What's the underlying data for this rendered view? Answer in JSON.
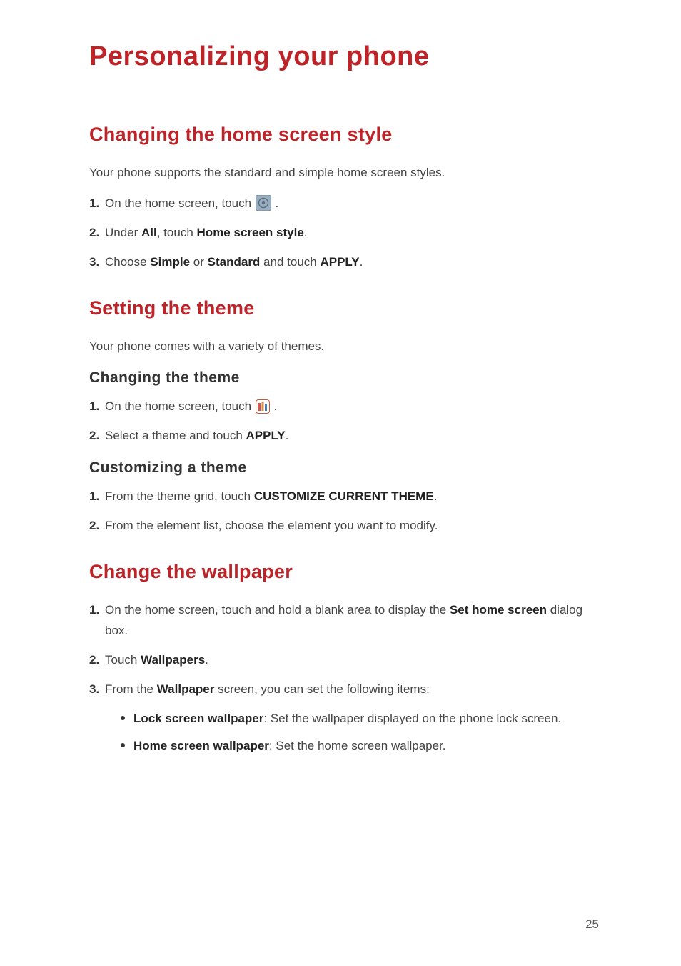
{
  "page": {
    "title": "Personalizing your phone",
    "number": "25"
  },
  "sec1": {
    "heading": "Changing the home screen style",
    "intro": "Your phone supports the standard and simple home screen styles.",
    "s1": {
      "num": "1.",
      "a": "On the home screen, touch ",
      "b": "."
    },
    "s2": {
      "num": "2.",
      "a": "Under ",
      "all": "All",
      "b": ", touch ",
      "hss": "Home screen style",
      "c": "."
    },
    "s3": {
      "num": "3.",
      "a": "Choose ",
      "simple": "Simple",
      "b": " or ",
      "standard": "Standard",
      "c": " and touch ",
      "apply": "APPLY",
      "d": "."
    }
  },
  "sec2": {
    "heading": "Setting the theme",
    "intro": "Your phone comes with a variety of themes."
  },
  "sec2a": {
    "heading": "Changing  the  theme",
    "s1": {
      "num": "1.",
      "a": "On the home screen, touch ",
      "b": "."
    },
    "s2": {
      "num": "2.",
      "a": "Select a theme and touch ",
      "apply": "APPLY",
      "b": "."
    }
  },
  "sec2b": {
    "heading": "Customizing  a  theme",
    "s1": {
      "num": "1.",
      "a": "From the theme grid, touch ",
      "cct": "CUSTOMIZE CURRENT THEME",
      "b": "."
    },
    "s2": {
      "num": "2.",
      "a": "From the element list, choose the element you want to modify."
    }
  },
  "sec3": {
    "heading": "Change the wallpaper",
    "s1": {
      "num": "1.",
      "a": "On the home screen, touch and hold a blank area to display the ",
      "shs": "Set home screen",
      "b": " dialog box."
    },
    "s2": {
      "num": "2.",
      "a": "Touch ",
      "wp": "Wallpapers",
      "b": "."
    },
    "s3": {
      "num": "3.",
      "a": "From the ",
      "wp": "Wallpaper",
      "b": " screen, you can set the following items:"
    },
    "b1": {
      "label": "Lock screen wallpaper",
      "text": ": Set the wallpaper displayed on the phone lock screen."
    },
    "b2": {
      "label": "Home screen wallpaper",
      "text": ": Set the home screen wallpaper."
    }
  }
}
